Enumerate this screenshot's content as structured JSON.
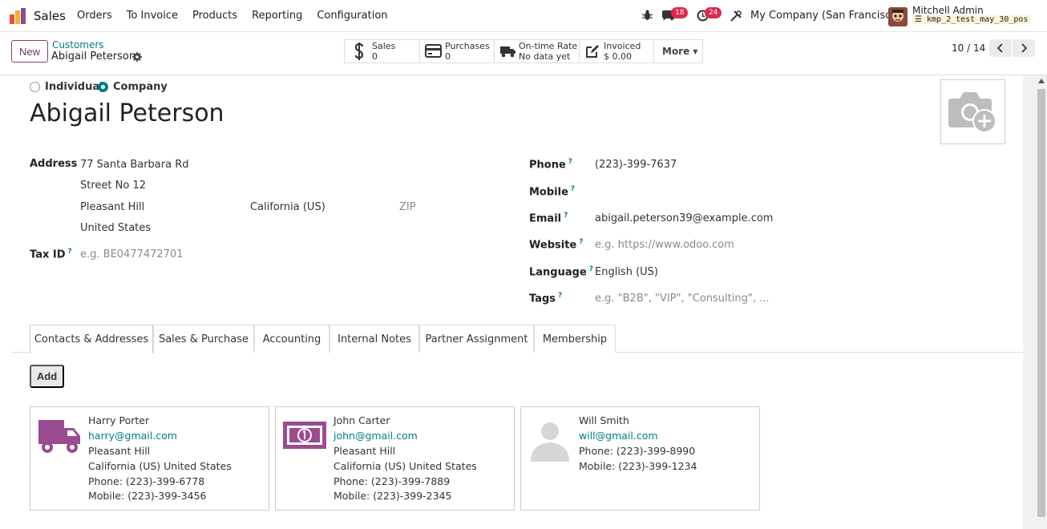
{
  "topbar": {
    "app_name": "Sales",
    "menu": [
      "Orders",
      "To Invoice",
      "Products",
      "Reporting",
      "Configuration"
    ],
    "messages_count": "18",
    "activities_count": "24",
    "company": "My Company (San Francisco)",
    "user": "Mitchell Admin",
    "database": "kmp_2_test_may_30_pos"
  },
  "control": {
    "new_label": "New",
    "breadcrumb_parent": "Customers",
    "breadcrumb_current": "Abigail Peterson",
    "stats": [
      {
        "label": "Sales",
        "value": "0"
      },
      {
        "label": "Purchases",
        "value": "0"
      },
      {
        "label": "On-time Rate",
        "value": "No data yet"
      },
      {
        "label": "Invoiced",
        "value": "$ 0.00"
      }
    ],
    "more_label": "More",
    "pager": "10 / 14"
  },
  "form": {
    "type_individual": "Individual",
    "type_company": "Company",
    "name": "Abigail Peterson",
    "address_label": "Address",
    "street": "77 Santa Barbara Rd",
    "street2": "Street No 12",
    "city": "Pleasant Hill",
    "state": "California (US)",
    "zip_placeholder": "ZIP",
    "country": "United States",
    "tax_label": "Tax ID",
    "tax_placeholder": "e.g. BE0477472701",
    "phone_label": "Phone",
    "phone": "(223)-399-7637",
    "mobile_label": "Mobile",
    "email_label": "Email",
    "email": "abigail.peterson39@example.com",
    "website_label": "Website",
    "website_placeholder": "e.g. https://www.odoo.com",
    "language_label": "Language",
    "language": "English (US)",
    "tags_label": "Tags",
    "tags_placeholder": "e.g. \"B2B\", \"VIP\", \"Consulting\", ...",
    "help_mark": "?"
  },
  "tabs": [
    "Contacts & Addresses",
    "Sales & Purchase",
    "Accounting",
    "Internal Notes",
    "Partner Assignment",
    "Membership"
  ],
  "contacts": {
    "add_label": "Add",
    "cards": [
      {
        "name": "Harry Porter",
        "email": "harry@gmail.com",
        "city": "Pleasant Hill",
        "region": "California (US) United States",
        "phone": "Phone: (223)-399-6778",
        "mobile": "Mobile: (223)-399-3456",
        "icon": "truck-icon"
      },
      {
        "name": "John Carter",
        "email": "john@gmail.com",
        "city": "Pleasant Hill",
        "region": "California (US) United States",
        "phone": "Phone: (223)-399-7889",
        "mobile": "Mobile: (223)-399-2345",
        "icon": "money-icon"
      },
      {
        "name": "Will Smith",
        "email": "will@gmail.com",
        "phone": "Phone: (223)-399-8990",
        "mobile": "Mobile: (223)-399-1234",
        "icon": "person-placeholder-icon"
      }
    ]
  },
  "colors": {
    "brand": "#71365a",
    "accent": "#017e84",
    "badge": "#e0284f",
    "contact_icon": "#9b4b8f"
  }
}
